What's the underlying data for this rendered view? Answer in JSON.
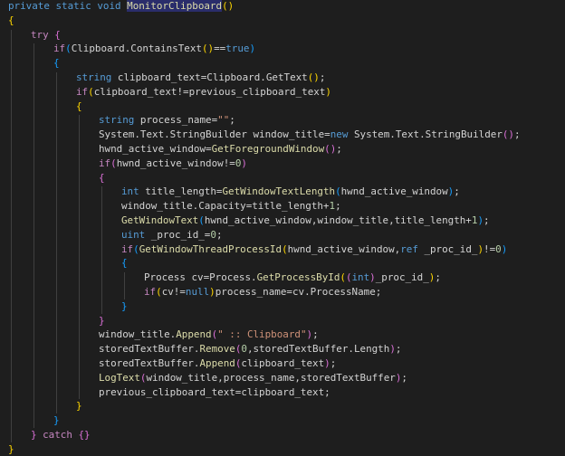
{
  "lines": [
    {
      "indent": 0,
      "tokens": [
        {
          "t": "private static void ",
          "c": "kw"
        },
        {
          "t": "MonitorClipboard",
          "c": "fn hl"
        },
        {
          "t": "()",
          "c": "b1"
        }
      ]
    },
    {
      "indent": 0,
      "tokens": [
        {
          "t": "{",
          "c": "b1"
        }
      ]
    },
    {
      "indent": 1,
      "tokens": [
        {
          "t": "try ",
          "c": "ctrl"
        },
        {
          "t": "{",
          "c": "b2"
        }
      ]
    },
    {
      "indent": 2,
      "tokens": [
        {
          "t": "if",
          "c": "ctrl"
        },
        {
          "t": "(",
          "c": "b3"
        },
        {
          "t": "Clipboard",
          "c": "p"
        },
        {
          "t": ".",
          "c": "p"
        },
        {
          "t": "ContainsText",
          "c": "p"
        },
        {
          "t": "()",
          "c": "b1"
        },
        {
          "t": "==",
          "c": "p"
        },
        {
          "t": "true",
          "c": "kw"
        },
        {
          "t": ")",
          "c": "b3"
        }
      ]
    },
    {
      "indent": 2,
      "tokens": [
        {
          "t": "{",
          "c": "b3"
        }
      ]
    },
    {
      "indent": 3,
      "tokens": [
        {
          "t": "string ",
          "c": "kw"
        },
        {
          "t": "clipboard_text",
          "c": "p"
        },
        {
          "t": "=",
          "c": "p"
        },
        {
          "t": "Clipboard",
          "c": "p"
        },
        {
          "t": ".",
          "c": "p"
        },
        {
          "t": "GetText",
          "c": "p"
        },
        {
          "t": "()",
          "c": "b1"
        },
        {
          "t": ";",
          "c": "p"
        }
      ]
    },
    {
      "indent": 3,
      "tokens": [
        {
          "t": "if",
          "c": "ctrl"
        },
        {
          "t": "(",
          "c": "b1"
        },
        {
          "t": "clipboard_text!=previous_clipboard_text",
          "c": "p"
        },
        {
          "t": ")",
          "c": "b1"
        }
      ]
    },
    {
      "indent": 3,
      "tokens": [
        {
          "t": "{",
          "c": "b1"
        }
      ]
    },
    {
      "indent": 4,
      "tokens": [
        {
          "t": "string ",
          "c": "kw"
        },
        {
          "t": "process_name=",
          "c": "p"
        },
        {
          "t": "\"\"",
          "c": "str"
        },
        {
          "t": ";",
          "c": "p"
        }
      ]
    },
    {
      "indent": 4,
      "tokens": [
        {
          "t": "System.Text.StringBuilder window_title=",
          "c": "p"
        },
        {
          "t": "new ",
          "c": "kw"
        },
        {
          "t": "System.Text.StringBuilder",
          "c": "p"
        },
        {
          "t": "()",
          "c": "b2"
        },
        {
          "t": ";",
          "c": "p"
        }
      ]
    },
    {
      "indent": 4,
      "tokens": [
        {
          "t": "hwnd_active_window=",
          "c": "p"
        },
        {
          "t": "GetForegroundWindow",
          "c": "fn"
        },
        {
          "t": "()",
          "c": "b2"
        },
        {
          "t": ";",
          "c": "p"
        }
      ]
    },
    {
      "indent": 4,
      "tokens": [
        {
          "t": "if",
          "c": "ctrl"
        },
        {
          "t": "(",
          "c": "b2"
        },
        {
          "t": "hwnd_active_window!=",
          "c": "p"
        },
        {
          "t": "0",
          "c": "num"
        },
        {
          "t": ")",
          "c": "b2"
        }
      ]
    },
    {
      "indent": 4,
      "tokens": [
        {
          "t": "{",
          "c": "b2"
        }
      ]
    },
    {
      "indent": 5,
      "tokens": [
        {
          "t": "int ",
          "c": "kw"
        },
        {
          "t": "title_length=",
          "c": "p"
        },
        {
          "t": "GetWindowTextLength",
          "c": "fn"
        },
        {
          "t": "(",
          "c": "b3"
        },
        {
          "t": "hwnd_active_window",
          "c": "p"
        },
        {
          "t": ")",
          "c": "b3"
        },
        {
          "t": ";",
          "c": "p"
        }
      ]
    },
    {
      "indent": 5,
      "tokens": [
        {
          "t": "window_title.Capacity=title_length+",
          "c": "p"
        },
        {
          "t": "1",
          "c": "num"
        },
        {
          "t": ";",
          "c": "p"
        }
      ]
    },
    {
      "indent": 5,
      "tokens": [
        {
          "t": "GetWindowText",
          "c": "fn"
        },
        {
          "t": "(",
          "c": "b3"
        },
        {
          "t": "hwnd_active_window,window_title,title_length+",
          "c": "p"
        },
        {
          "t": "1",
          "c": "num"
        },
        {
          "t": ")",
          "c": "b3"
        },
        {
          "t": ";",
          "c": "p"
        }
      ]
    },
    {
      "indent": 5,
      "tokens": [
        {
          "t": "uint ",
          "c": "kw"
        },
        {
          "t": "_proc_id_=",
          "c": "p"
        },
        {
          "t": "0",
          "c": "num"
        },
        {
          "t": ";",
          "c": "p"
        }
      ]
    },
    {
      "indent": 5,
      "tokens": [
        {
          "t": "if",
          "c": "ctrl"
        },
        {
          "t": "(",
          "c": "b3"
        },
        {
          "t": "GetWindowThreadProcessId",
          "c": "fn"
        },
        {
          "t": "(",
          "c": "b1"
        },
        {
          "t": "hwnd_active_window,",
          "c": "p"
        },
        {
          "t": "ref ",
          "c": "kw"
        },
        {
          "t": "_proc_id_",
          "c": "p"
        },
        {
          "t": ")",
          "c": "b1"
        },
        {
          "t": "!=",
          "c": "p"
        },
        {
          "t": "0",
          "c": "num"
        },
        {
          "t": ")",
          "c": "b3"
        }
      ]
    },
    {
      "indent": 5,
      "tokens": [
        {
          "t": "{",
          "c": "b3"
        }
      ]
    },
    {
      "indent": 6,
      "tokens": [
        {
          "t": "Process cv=Process.",
          "c": "p"
        },
        {
          "t": "GetProcessById",
          "c": "fn"
        },
        {
          "t": "(",
          "c": "b1"
        },
        {
          "t": "(",
          "c": "b2"
        },
        {
          "t": "int",
          "c": "kw"
        },
        {
          "t": ")",
          "c": "b2"
        },
        {
          "t": "_proc_id_",
          "c": "p"
        },
        {
          "t": ")",
          "c": "b1"
        },
        {
          "t": ";",
          "c": "p"
        }
      ]
    },
    {
      "indent": 6,
      "tokens": [
        {
          "t": "if",
          "c": "ctrl"
        },
        {
          "t": "(",
          "c": "b1"
        },
        {
          "t": "cv!=",
          "c": "p"
        },
        {
          "t": "null",
          "c": "kw"
        },
        {
          "t": ")",
          "c": "b1"
        },
        {
          "t": "process_name=cv.ProcessName;",
          "c": "p"
        }
      ]
    },
    {
      "indent": 5,
      "tokens": [
        {
          "t": "}",
          "c": "b3"
        }
      ]
    },
    {
      "indent": 4,
      "tokens": [
        {
          "t": "}",
          "c": "b2"
        }
      ]
    },
    {
      "indent": 4,
      "tokens": [
        {
          "t": "window_title.",
          "c": "p"
        },
        {
          "t": "Append",
          "c": "fn"
        },
        {
          "t": "(",
          "c": "b2"
        },
        {
          "t": "\" :: Clipboard\"",
          "c": "str"
        },
        {
          "t": ")",
          "c": "b2"
        },
        {
          "t": ";",
          "c": "p"
        }
      ]
    },
    {
      "indent": 4,
      "tokens": [
        {
          "t": "storedTextBuffer.",
          "c": "p"
        },
        {
          "t": "Remove",
          "c": "fn"
        },
        {
          "t": "(",
          "c": "b2"
        },
        {
          "t": "0",
          "c": "num"
        },
        {
          "t": ",storedTextBuffer.Length",
          "c": "p"
        },
        {
          "t": ")",
          "c": "b2"
        },
        {
          "t": ";",
          "c": "p"
        }
      ]
    },
    {
      "indent": 4,
      "tokens": [
        {
          "t": "storedTextBuffer.",
          "c": "p"
        },
        {
          "t": "Append",
          "c": "fn"
        },
        {
          "t": "(",
          "c": "b2"
        },
        {
          "t": "clipboard_text",
          "c": "p"
        },
        {
          "t": ")",
          "c": "b2"
        },
        {
          "t": ";",
          "c": "p"
        }
      ]
    },
    {
      "indent": 4,
      "tokens": [
        {
          "t": "LogText",
          "c": "fn"
        },
        {
          "t": "(",
          "c": "b2"
        },
        {
          "t": "window_title,process_name,storedTextBuffer",
          "c": "p"
        },
        {
          "t": ")",
          "c": "b2"
        },
        {
          "t": ";",
          "c": "p"
        }
      ]
    },
    {
      "indent": 4,
      "tokens": [
        {
          "t": "previous_clipboard_text=clipboard_text;",
          "c": "p"
        }
      ]
    },
    {
      "indent": 3,
      "tokens": [
        {
          "t": "}",
          "c": "b1"
        }
      ]
    },
    {
      "indent": 2,
      "tokens": [
        {
          "t": "}",
          "c": "b3"
        }
      ]
    },
    {
      "indent": 1,
      "tokens": [
        {
          "t": "} ",
          "c": "b2"
        },
        {
          "t": "catch ",
          "c": "ctrl"
        },
        {
          "t": "{}",
          "c": "b2"
        }
      ]
    },
    {
      "indent": 0,
      "tokens": [
        {
          "t": "}",
          "c": "b1"
        }
      ]
    }
  ],
  "colors": {
    "background": "#1e1e1e",
    "keyword": "#569cd6",
    "control": "#c586c0",
    "function": "#dcdcaa",
    "string": "#ce9178",
    "number": "#b5cea8",
    "bracket_gold": "#ffd700",
    "bracket_orchid": "#da70d6",
    "bracket_blue": "#179fff"
  }
}
